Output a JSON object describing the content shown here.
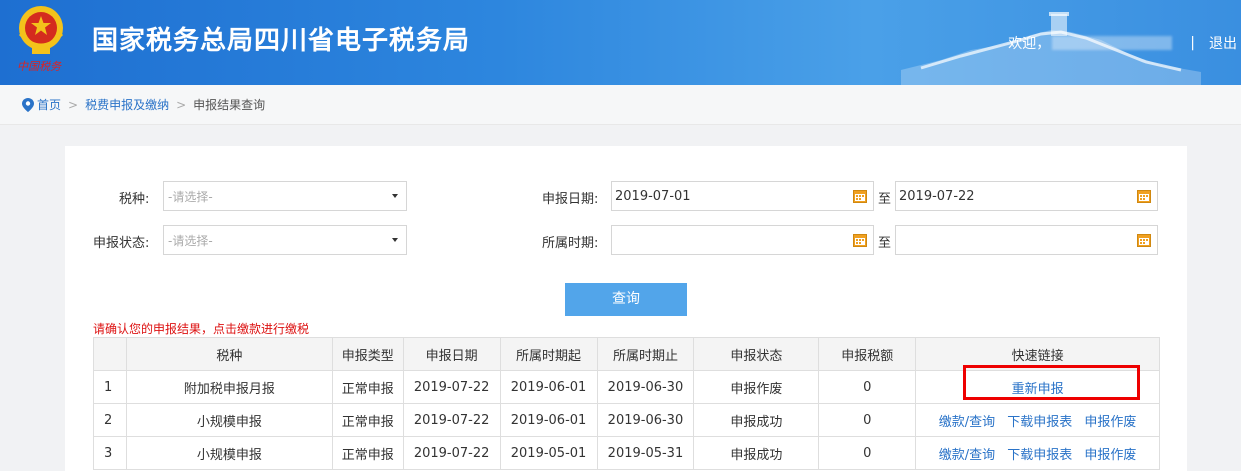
{
  "header": {
    "site_title": "国家税务总局四川省电子税务局",
    "emblem_caption": "中国税务",
    "welcome": "欢迎，",
    "separator": "|",
    "logout": "退出"
  },
  "breadcrumb": {
    "home": "首页",
    "items": [
      "税费申报及缴纳",
      "申报结果查询"
    ]
  },
  "form": {
    "tax_type_label": "税种:",
    "tax_type_placeholder": "-请选择-",
    "status_label": "申报状态:",
    "status_placeholder": "-请选择-",
    "decl_date_label": "申报日期:",
    "decl_date_from": "2019-07-01",
    "decl_date_to": "2019-07-22",
    "period_label": "所属时期:",
    "period_from": "",
    "period_to": "",
    "to_label": "至",
    "query_button": "查询"
  },
  "notice": "请确认您的申报结果，点击缴款进行缴税",
  "table": {
    "headers": [
      "",
      "税种",
      "申报类型",
      "申报日期",
      "所属时期起",
      "所属时期止",
      "申报状态",
      "申报税额",
      "快速链接"
    ],
    "rows": [
      {
        "idx": "1",
        "tax": "附加税申报月报",
        "type": "正常申报",
        "date": "2019-07-22",
        "start": "2019-06-01",
        "end": "2019-06-30",
        "status": "申报作废",
        "amount": "0",
        "links": [
          "重新申报"
        ]
      },
      {
        "idx": "2",
        "tax": "小规模申报",
        "type": "正常申报",
        "date": "2019-07-22",
        "start": "2019-06-01",
        "end": "2019-06-30",
        "status": "申报成功",
        "amount": "0",
        "links": [
          "缴款/查询",
          "下载申报表",
          "申报作废"
        ]
      },
      {
        "idx": "3",
        "tax": "小规模申报",
        "type": "正常申报",
        "date": "2019-07-22",
        "start": "2019-05-01",
        "end": "2019-05-31",
        "status": "申报成功",
        "amount": "0",
        "links": [
          "缴款/查询",
          "下载申报表",
          "申报作废"
        ]
      }
    ]
  },
  "colors": {
    "header_blue": "#2d86de",
    "link_blue": "#2a73c8",
    "button_blue": "#52a5ea",
    "notice_red": "#dd1111",
    "highlight_red": "#ee0000",
    "calendar_orange": "#f0a020"
  }
}
